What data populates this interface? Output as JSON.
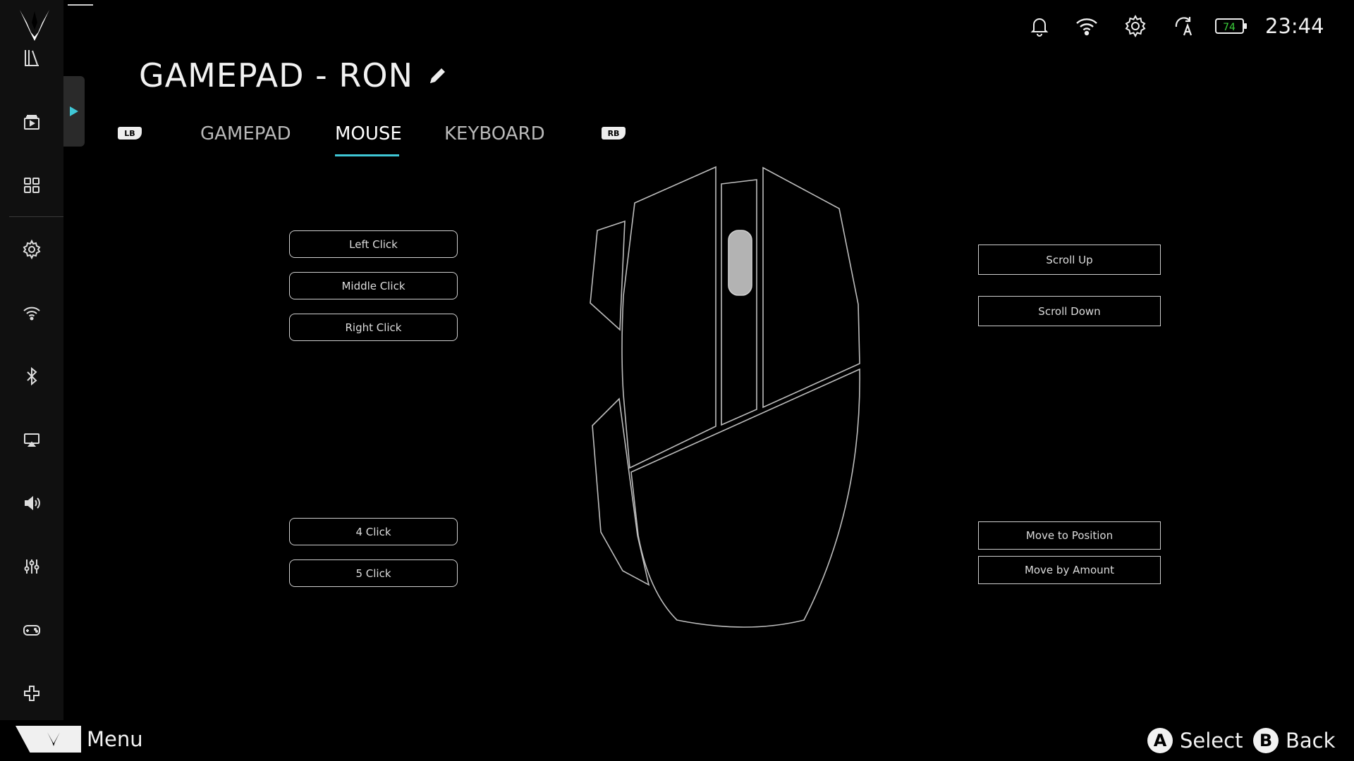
{
  "page": {
    "title": "GAMEPAD - RON"
  },
  "tabs": {
    "left_bumper": "LB",
    "right_bumper": "RB",
    "items": [
      {
        "label": "GAMEPAD",
        "active": false
      },
      {
        "label": "MOUSE",
        "active": true
      },
      {
        "label": "KEYBOARD",
        "active": false
      }
    ],
    "accent_color": "#3fc7d6"
  },
  "bindings": {
    "left": [
      "Left Click",
      "Middle Click",
      "Right Click",
      "4 Click",
      "5 Click"
    ],
    "right": [
      "Scroll Up",
      "Scroll Down",
      "Move to Position",
      "Move by Amount"
    ]
  },
  "sidebar": {
    "items": [
      "library-icon",
      "media-icon",
      "apps-grid-icon",
      "settings-icon",
      "wifi-icon",
      "bluetooth-icon",
      "display-cast-icon",
      "volume-icon",
      "sliders-icon",
      "controller-icon",
      "dpad-icon"
    ]
  },
  "status": {
    "time": "23:44",
    "battery": "74",
    "battery_color": "#3bd13b"
  },
  "footer": {
    "menu_label": "Menu",
    "select_button": "A",
    "select_label": "Select",
    "back_button": "B",
    "back_label": "Back"
  }
}
